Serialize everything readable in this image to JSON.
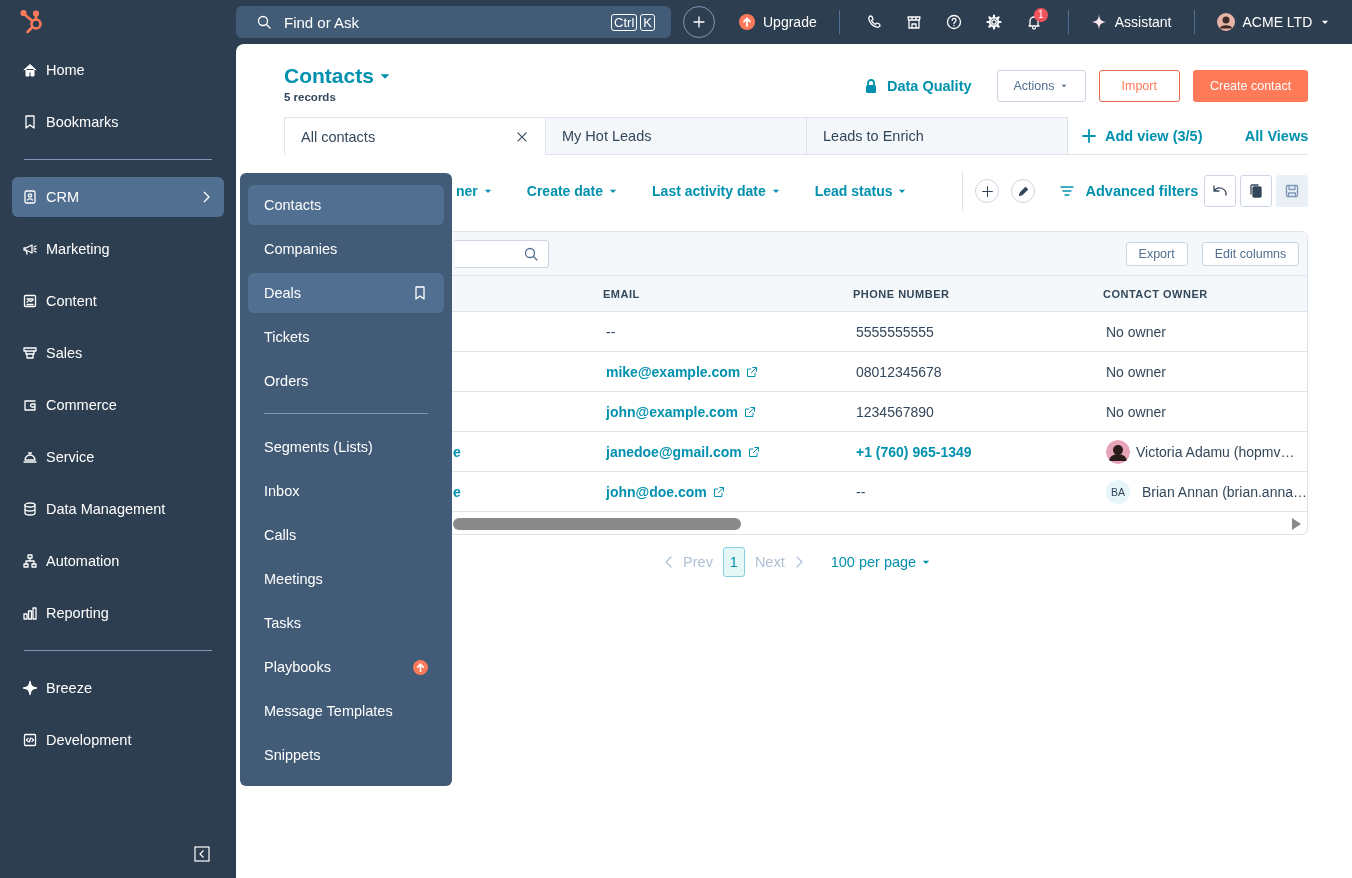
{
  "topbar": {
    "search": {
      "placeholder": "Find or Ask",
      "keys": [
        "Ctrl",
        "K"
      ]
    },
    "upgrade": "Upgrade",
    "notifications": "1",
    "assistant": "Assistant",
    "account": "ACME LTD"
  },
  "sidebar": {
    "groups": [
      [
        {
          "label": "Home",
          "selected": false
        },
        {
          "label": "Bookmarks",
          "selected": false
        }
      ],
      [
        {
          "label": "CRM",
          "selected": true,
          "submenu": true
        },
        {
          "label": "Marketing",
          "selected": false
        },
        {
          "label": "Content",
          "selected": false
        },
        {
          "label": "Sales",
          "selected": false
        },
        {
          "label": "Commerce",
          "selected": false
        },
        {
          "label": "Service",
          "selected": false
        },
        {
          "label": "Data Management",
          "selected": false
        },
        {
          "label": "Automation",
          "selected": false
        },
        {
          "label": "Reporting",
          "selected": false
        }
      ],
      [
        {
          "label": "Breeze",
          "selected": false
        },
        {
          "label": "Development",
          "selected": false
        }
      ]
    ]
  },
  "flyout": {
    "groups": [
      [
        {
          "label": "Contacts",
          "selected": true,
          "hovered": false
        },
        {
          "label": "Companies",
          "selected": false,
          "hovered": false
        },
        {
          "label": "Deals",
          "selected": true,
          "hovered": true
        },
        {
          "label": "Tickets",
          "selected": false,
          "hovered": false
        },
        {
          "label": "Orders",
          "selected": false,
          "hovered": false
        }
      ],
      [
        {
          "label": "Segments (Lists)",
          "selected": false,
          "hovered": false
        },
        {
          "label": "Inbox",
          "selected": false,
          "hovered": false
        },
        {
          "label": "Calls",
          "selected": false,
          "hovered": false
        },
        {
          "label": "Meetings",
          "selected": false,
          "hovered": false
        },
        {
          "label": "Tasks",
          "selected": false,
          "hovered": false
        },
        {
          "label": "Playbooks",
          "selected": false,
          "hovered": false,
          "upgrade": true
        },
        {
          "label": "Message Templates",
          "selected": false,
          "hovered": false
        },
        {
          "label": "Snippets",
          "selected": false,
          "hovered": false
        }
      ]
    ]
  },
  "page": {
    "title": "Contacts",
    "record_count": "5 records",
    "data_quality": "Data Quality",
    "actions": "Actions",
    "import": "Import",
    "create": "Create contact"
  },
  "views": {
    "tabs": [
      {
        "label": "All contacts",
        "selected": true,
        "closable": true
      },
      {
        "label": "My Hot Leads",
        "selected": false,
        "closable": false
      },
      {
        "label": "Leads to Enrich",
        "selected": false,
        "closable": false
      }
    ],
    "add_view": "Add view (3/5)",
    "all_views": "All Views"
  },
  "filters": {
    "items": [
      "ner",
      "Create date",
      "Last activity date",
      "Lead status"
    ],
    "advanced": "Advanced filters",
    "save_disabled": true
  },
  "table": {
    "export": "Export",
    "edit_columns": "Edit columns",
    "columns": [
      "EMAIL",
      "PHONE NUMBER",
      "CONTACT OWNER"
    ],
    "rows": [
      {
        "email": {
          "text": "--",
          "link": false
        },
        "phone": {
          "text": "5555555555",
          "link": false
        },
        "owner": {
          "text": "No owner",
          "kind": "plain"
        }
      },
      {
        "email": {
          "text": "mike@example.com",
          "link": true
        },
        "phone": {
          "text": "08012345678",
          "link": false
        },
        "owner": {
          "text": "No owner",
          "kind": "plain"
        }
      },
      {
        "email": {
          "text": "john@example.com",
          "link": true
        },
        "phone": {
          "text": "1234567890",
          "link": false
        },
        "owner": {
          "text": "No owner",
          "kind": "plain"
        }
      },
      {
        "name": "e",
        "email": {
          "text": "janedoe@gmail.com",
          "link": true
        },
        "phone": {
          "text": "+1 (760) 965-1349",
          "link": true
        },
        "owner": {
          "text": "Victoria Adamu (hopmv…",
          "kind": "photo"
        }
      },
      {
        "name": "e",
        "email": {
          "text": "john@doe.com",
          "link": true
        },
        "phone": {
          "text": "--",
          "link": false
        },
        "owner": {
          "text": "Brian Annan (brian.anna…",
          "kind": "initials",
          "initials": "BA"
        }
      }
    ]
  },
  "pagination": {
    "prev": "Prev",
    "page": "1",
    "next": "Next",
    "per_page": "100 per page",
    "prev_disabled": true,
    "next_disabled": true
  }
}
